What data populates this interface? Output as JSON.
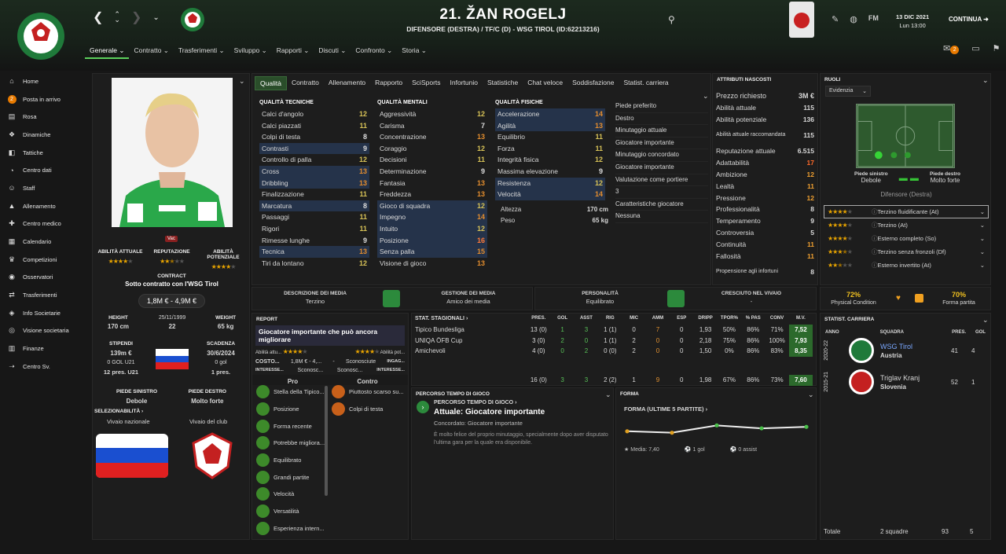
{
  "header": {
    "name": "21. ŽAN ROGELJ",
    "subtitle": "DIFENSORE (DESTRA) / TF/C (D) - WSG TIROL (ID:62213216)",
    "date": "13 DIC 2021",
    "time": "Lun 13:00",
    "continue": "CONTINUA",
    "fm": "FM",
    "mail_badge": "2"
  },
  "menu": [
    "Generale",
    "Contratto",
    "Trasferimenti",
    "Sviluppo",
    "Rapporti",
    "Discuti",
    "Confronto",
    "Storia"
  ],
  "sidebar": [
    {
      "label": "Home",
      "icon": "home-icon"
    },
    {
      "label": "Posta in arrivo",
      "icon": "inbox-icon",
      "badge": "2"
    },
    {
      "label": "Rosa",
      "icon": "shirt-icon"
    },
    {
      "label": "Dinamiche",
      "icon": "dynamics-icon"
    },
    {
      "label": "Tattiche",
      "icon": "tactics-icon"
    },
    {
      "label": "Centro dati",
      "icon": "data-icon"
    },
    {
      "label": "Staff",
      "icon": "staff-icon"
    },
    {
      "label": "Allenamento",
      "icon": "training-icon"
    },
    {
      "label": "Centro medico",
      "icon": "medical-icon"
    },
    {
      "label": "Calendario",
      "icon": "calendar-icon"
    },
    {
      "label": "Competizioni",
      "icon": "trophy-icon"
    },
    {
      "label": "Osservatori",
      "icon": "scout-icon"
    },
    {
      "label": "Trasferimenti",
      "icon": "transfer-icon"
    },
    {
      "label": "Info Societarie",
      "icon": "club-icon"
    },
    {
      "label": "Visione societaria",
      "icon": "vision-icon"
    },
    {
      "label": "Finanze",
      "icon": "finance-icon"
    },
    {
      "label": "Centro Sv.",
      "icon": "dev-icon"
    }
  ],
  "profile": {
    "vac": "Vac",
    "ability_labels": [
      "ABILITÀ ATTUALE",
      "REPUTAZIONE",
      "ABILITÀ POTENZIALE"
    ],
    "ability_stars": [
      4,
      2.5,
      4
    ],
    "contract_label": "CONTRACT",
    "contract_text": "Sotto contratto con l'WSG Tirol",
    "value": "1,8M € - 4,9M €",
    "height_label": "HEIGHT",
    "height": "170 cm",
    "dob": "25/11/1999",
    "age": "22",
    "weight_label": "WEIGHT",
    "weight": "65 kg",
    "wage_label": "STIPENDI",
    "wage": "139m €",
    "u21": "0 GOL U21",
    "apps_u21": "12 pres. U21",
    "expiry_label": "SCADENZA",
    "expiry": "30/6/2024",
    "goals": "0 gol",
    "apps": "1 pres.",
    "left_foot_label": "PIEDE SINISTRO",
    "left_foot": "Debole",
    "right_foot_label": "PIEDE DESTRO",
    "right_foot": "Molto forte",
    "selectability": "SELEZIONABILITÀ",
    "national": "Vivaio nazionale",
    "club": "Vivaio del club"
  },
  "tabs": [
    "Qualità",
    "Contratto",
    "Allenamento",
    "Rapporto",
    "SciSports",
    "Infortunio",
    "Statistiche",
    "Chat veloce",
    "Soddisfazione",
    "Statist. carriera"
  ],
  "technical": {
    "title": "QUALITÀ TECNICHE",
    "rows": [
      [
        "Calci d'angolo",
        "12",
        "c-mid",
        false
      ],
      [
        "Calci piazzati",
        "11",
        "c-mid",
        false
      ],
      [
        "Colpi di testa",
        "8",
        "c-lo",
        false
      ],
      [
        "Contrasti",
        "9",
        "c-lo",
        true
      ],
      [
        "Controllo di palla",
        "12",
        "c-mid",
        false
      ],
      [
        "Cross",
        "13",
        "c-hi",
        true
      ],
      [
        "Dribbling",
        "13",
        "c-hi",
        true
      ],
      [
        "Finalizzazione",
        "11",
        "c-mid",
        false
      ],
      [
        "Marcatura",
        "8",
        "c-lo",
        true
      ],
      [
        "Passaggi",
        "11",
        "c-mid",
        false
      ],
      [
        "Rigori",
        "11",
        "c-mid",
        false
      ],
      [
        "Rimesse lunghe",
        "9",
        "c-lo",
        false
      ],
      [
        "Tecnica",
        "13",
        "c-hi",
        true
      ],
      [
        "Tiri da lontano",
        "12",
        "c-mid",
        false
      ]
    ]
  },
  "mental": {
    "title": "QUALITÀ MENTALI",
    "rows": [
      [
        "Aggressività",
        "12",
        "c-mid",
        false
      ],
      [
        "Carisma",
        "7",
        "c-lo",
        false
      ],
      [
        "Concentrazione",
        "13",
        "c-hi",
        false
      ],
      [
        "Coraggio",
        "12",
        "c-mid",
        false
      ],
      [
        "Decisioni",
        "11",
        "c-mid",
        false
      ],
      [
        "Determinazione",
        "9",
        "c-lo",
        false
      ],
      [
        "Fantasia",
        "13",
        "c-hi",
        false
      ],
      [
        "Freddezza",
        "13",
        "c-hi",
        false
      ],
      [
        "Gioco di squadra",
        "12",
        "c-mid",
        true
      ],
      [
        "Impegno",
        "14",
        "c-hi",
        true
      ],
      [
        "Intuito",
        "12",
        "c-mid",
        true
      ],
      [
        "Posizione",
        "16",
        "c-top",
        true
      ],
      [
        "Senza palla",
        "15",
        "c-hi",
        true
      ],
      [
        "Visione di gioco",
        "13",
        "c-hi",
        false
      ]
    ]
  },
  "physical": {
    "title": "QUALITÀ FISICHE",
    "rows": [
      [
        "Accelerazione",
        "14",
        "c-hi",
        true
      ],
      [
        "Agilità",
        "13",
        "c-hi",
        true
      ],
      [
        "Equilibrio",
        "11",
        "c-mid",
        false
      ],
      [
        "Forza",
        "11",
        "c-mid",
        false
      ],
      [
        "Integrità fisica",
        "12",
        "c-mid",
        false
      ],
      [
        "Massima elevazione",
        "9",
        "c-lo",
        false
      ],
      [
        "Resistenza",
        "12",
        "c-mid",
        true
      ],
      [
        "Velocità",
        "14",
        "c-hi",
        true
      ]
    ],
    "height_label": "Altezza",
    "height": "170 cm",
    "weight_label": "Peso",
    "weight": "65 kg"
  },
  "prefs": [
    "Piede preferito",
    "Destro",
    "Minutaggio attuale",
    "Giocatore importante",
    "Minutaggio concordato",
    "Giocatore importante",
    "Valutazione come portiere",
    "3",
    "Caratteristiche giocatore",
    "Nessuna"
  ],
  "hidden": {
    "title": "ATTRIBUTI NASCOSTI",
    "price_label": "Prezzo richiesto",
    "price": "3M €",
    "rows": [
      [
        "Abilità attuale",
        "115"
      ],
      [
        "Abilità potenziale",
        "136"
      ],
      [
        "Abilità attuale raccomandata",
        "115"
      ],
      [
        "Reputazione attuale",
        "6.515"
      ],
      [
        "Adattabilità",
        "17"
      ],
      [
        "Ambizione",
        "12"
      ],
      [
        "Lealtà",
        "11"
      ],
      [
        "Pressione",
        "12"
      ],
      [
        "Professionalità",
        "8"
      ],
      [
        "Temperamento",
        "9"
      ],
      [
        "Controversia",
        "5"
      ],
      [
        "Continuità",
        "11"
      ],
      [
        "Fallosità",
        "11"
      ],
      [
        "Propensione agli infortuni",
        "8"
      ]
    ]
  },
  "roles": {
    "title": "RUOLI",
    "filter": "Evidenzia",
    "left_foot_label": "Piede sinistro",
    "left_foot": "Debole",
    "right_foot_label": "Piede destro",
    "right_foot": "Molto forte",
    "position": "Difensore (Destra)",
    "list": [
      [
        "Terzino fluidificante (At)",
        4
      ],
      [
        "Terzino (At)",
        4
      ],
      [
        "Esterno completo (So)",
        4
      ],
      [
        "Terzino senza fronzoli (Df)",
        3.5
      ],
      [
        "Esterno invertito (At)",
        2.5
      ]
    ]
  },
  "media": {
    "desc_label": "DESCRIZIONE DEI MEDIA",
    "desc": "Terzino",
    "mgmt_label": "GESTIONE DEI MEDIA",
    "mgmt": "Amico dei media",
    "pers_label": "PERSONALITÀ",
    "pers": "Equilibrato",
    "youth_label": "CRESCIUTO NEL VIVAIO",
    "youth": "-"
  },
  "condition": {
    "phys": "72%",
    "phys_label": "Physical Condition",
    "form": "70%",
    "form_label": "Forma partita"
  },
  "report": {
    "title": "REPORT",
    "headline": "Giocatore importante che può ancora migliorare",
    "aa_label": "Abilità attu...",
    "ap_label": "Abilità pot...",
    "cost_label": "COSTO...",
    "cost": "1,8M € - 4,...",
    "cost2": "Sconosciute",
    "inga": "INGAG...",
    "int_label": "INTERESSE...",
    "int1": "Sconosc...",
    "int2": "Sconosc...",
    "int3": "INTERESSE...",
    "pro": "Pro",
    "con": "Contro",
    "pros": [
      "Stella della Tipico...",
      "Posizione",
      "Forma recente",
      "Potrebbe migliora...",
      "Equilibrato",
      "Grandi partite",
      "Velocità",
      "Versatilità",
      "Esperienza intern..."
    ],
    "cons": [
      "Piuttosto scarso su...",
      "Colpi di testa"
    ]
  },
  "season": {
    "title": "STAT. STAGIONALI",
    "cols": [
      "PRES.",
      "GOL",
      "ASST",
      "RIG",
      "MIC",
      "AMM",
      "ESP",
      "DRIPP",
      "TPOR%",
      "% PAS",
      "CONV",
      "M.V."
    ],
    "rows": [
      [
        "Tipico Bundesliga",
        "13 (0)",
        "1",
        "3",
        "1 (1)",
        "0",
        "7",
        "0",
        "1,93",
        "50%",
        "86%",
        "71%",
        "7,52"
      ],
      [
        "UNIQA ÖFB Cup",
        "3 (0)",
        "2",
        "0",
        "1 (1)",
        "2",
        "0",
        "0",
        "2,18",
        "75%",
        "86%",
        "100%",
        "7,93"
      ],
      [
        "Amichevoli",
        "4 (0)",
        "0",
        "2",
        "0 (0)",
        "2",
        "0",
        "0",
        "1,50",
        "0%",
        "86%",
        "83%",
        "8,35"
      ]
    ],
    "total": [
      "",
      "16 (0)",
      "3",
      "3",
      "2 (2)",
      "1",
      "9",
      "0",
      "1,98",
      "67%",
      "86%",
      "73%",
      "7,60"
    ]
  },
  "percorso": {
    "title": "PERCORSO TEMPO DI GIOCO",
    "sub": "PERCORSO TEMPO DI GIOCO",
    "head": "Attuale: Giocatore importante",
    "agreed": "Concordato: Giocatore importante",
    "text": "È molto felice del proprio minutaggio, specialmente dopo aver disputato l'ultima gara per la quale era disponibile."
  },
  "forma": {
    "title": "FORMA",
    "sub": "FORMA (ULTIME 5 PARTITE)",
    "values": [
      7.1,
      7.0,
      7.5,
      7.3,
      7.4
    ],
    "media": "Media: 7,40",
    "goals": "1 gol",
    "assists": "0 assist"
  },
  "career": {
    "title": "STATIST. CARRIERA",
    "cols": [
      "ANNO",
      "SQUADRA",
      "PRES.",
      "GOL"
    ],
    "rows": [
      [
        "2020-22",
        "WSG Tirol",
        "Austria",
        "41",
        "4"
      ],
      [
        "2015-21",
        "Triglav Kranj",
        "Slovenia",
        "52",
        "1"
      ]
    ],
    "total_label": "Totale",
    "total_teams": "2 squadre",
    "total_apps": "93",
    "total_goals": "5"
  },
  "colors": {
    "accent": "#5ccf5c",
    "hl": "#25334a"
  }
}
